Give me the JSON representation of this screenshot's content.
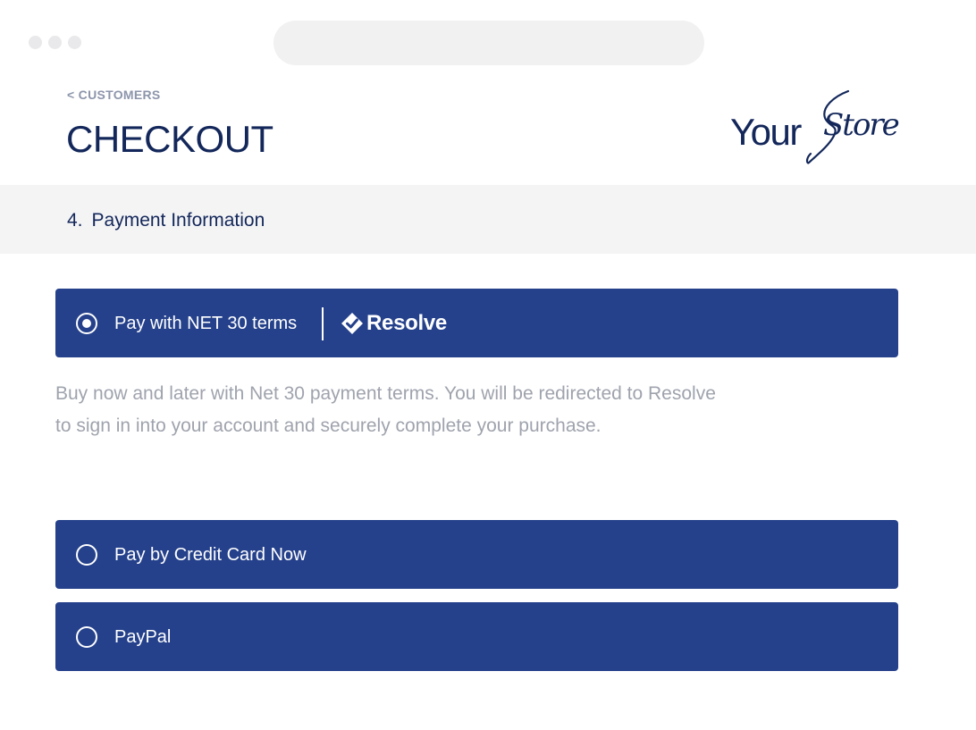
{
  "header": {
    "breadcrumb": "< CUSTOMERS",
    "title": "CHECKOUT",
    "logo": {
      "part1": "Your",
      "part2": "Store"
    }
  },
  "section": {
    "number": "4.",
    "title": "Payment Information"
  },
  "payment_options": [
    {
      "label": "Pay with NET 30 terms",
      "selected": true,
      "brand": "Resolve",
      "description_lines": [
        "Buy now and later with Net 30 payment terms. You will be redirected to Resolve",
        "to sign in into your account and securely complete your purchase."
      ]
    },
    {
      "label": "Pay by Credit Card Now",
      "selected": false
    },
    {
      "label": "PayPal",
      "selected": false
    }
  ],
  "colors": {
    "primary": "#25418b",
    "title": "#13275a",
    "muted": "#8d95ab",
    "description": "#9fa3ad",
    "section_bg": "#f4f4f5"
  },
  "icons": {
    "radio_selected": "radio-selected-icon",
    "radio_unselected": "radio-unselected-icon",
    "resolve_logo": "resolve-logo-icon"
  }
}
